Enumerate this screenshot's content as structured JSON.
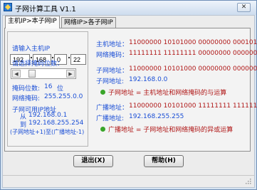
{
  "window": {
    "title": "子网计算工具  V1.1",
    "close_glyph": "✕"
  },
  "tabs": [
    {
      "label": "主机IP>本子网IP",
      "active": true
    },
    {
      "label": "网络IP>各子网IP",
      "active": false
    }
  ],
  "left": {
    "ip_label": "请输入主机IP",
    "ip": [
      "192",
      "168",
      "0",
      "22"
    ],
    "mask_label": "请选择掩码位数：",
    "mask_bits_label": "掩码位数:",
    "mask_bits_value": "16",
    "mask_bits_unit": "位",
    "net_mask_label": "网络掩码:",
    "net_mask_value": "255.255.0.0",
    "usable_label": "子网可用IP地址",
    "usable_from_label": "从",
    "usable_from": "192.168.0.1",
    "usable_to_label": "到",
    "usable_to": "192.168.255.254",
    "usable_note": "(子网地址+1)至(广播地址-1)"
  },
  "right": {
    "host_addr_label": "主机地址：",
    "host_addr_bin": "11000000 10101000 00000000 00010110",
    "net_mask_label": "网络掩码：",
    "net_mask_bin": "11111111 11111111 00000000 00000000",
    "subnet_label": "子网地址：",
    "subnet_bin": "11000000 10101000 00000000 00000000",
    "subnet_ip_label": "子网地址:",
    "subnet_ip": "192.168.0.0",
    "subnet_note": "子网地址 = 主机地址和网络掩码的与运算",
    "broadcast_label": "广播地址：",
    "broadcast_bin": "11000000 10101000 11111111 11111111",
    "broadcast_ip_label": "广播地址:",
    "broadcast_ip": "192.168.255.255",
    "broadcast_note": "广播地址 = 子网地址和网络掩码的异或运算"
  },
  "buttons": {
    "exit": "退出(X)",
    "help": "帮助(H)"
  },
  "colors": {
    "blue_text": "#1b4fd6",
    "red_text": "#b01818",
    "bullet": "#3aa52a"
  }
}
